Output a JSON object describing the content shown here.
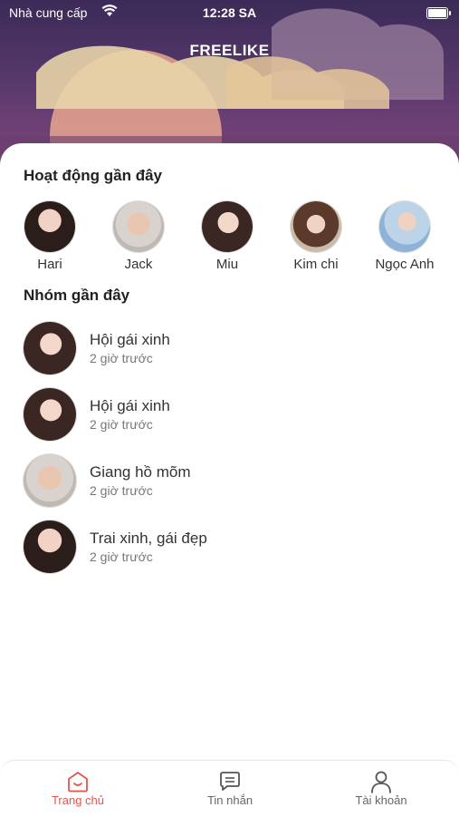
{
  "status_bar": {
    "carrier": "Nhà cung cấp",
    "time": "12:28 SA"
  },
  "app": {
    "title": "FREELIKE"
  },
  "recent_activity": {
    "title": "Hoạt động gần đây",
    "friends": [
      {
        "name": "Hari"
      },
      {
        "name": "Jack"
      },
      {
        "name": "Miu"
      },
      {
        "name": "Kim chi"
      },
      {
        "name": "Ngọc Anh"
      }
    ]
  },
  "recent_groups": {
    "title": "Nhóm gần đây",
    "groups": [
      {
        "name": "Hội gái xinh",
        "time": "2 giờ trước"
      },
      {
        "name": "Hội gái xinh",
        "time": "2 giờ trước"
      },
      {
        "name": "Giang hồ mõm",
        "time": "2 giờ trước"
      },
      {
        "name": "Trai xinh, gái đẹp",
        "time": "2 giờ trước"
      }
    ]
  },
  "tabbar": {
    "tabs": [
      {
        "label": "Trang chủ",
        "icon": "home-icon",
        "active": true
      },
      {
        "label": "Tin nhắn",
        "icon": "message-icon",
        "active": false
      },
      {
        "label": "Tài khoản",
        "icon": "user-icon",
        "active": false
      }
    ]
  },
  "colors": {
    "accent": "#e8544a",
    "header_bg": "#4f3566"
  }
}
